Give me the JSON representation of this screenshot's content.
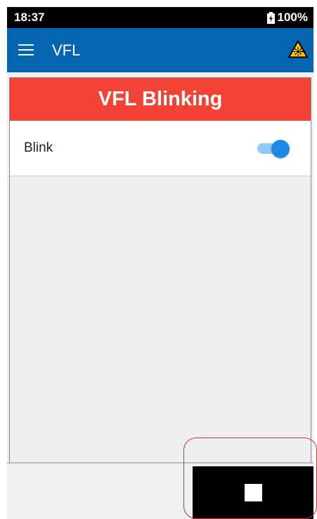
{
  "status_bar": {
    "time": "18:37",
    "battery": "100%",
    "battery_icon": "battery-charging-icon"
  },
  "app_bar": {
    "title": "VFL",
    "menu_icon": "hamburger-menu-icon",
    "warning_icon": "laser-warning-icon"
  },
  "banner": {
    "text": "VFL Blinking",
    "color": "#f44336"
  },
  "settings": [
    {
      "label": "Blink",
      "toggle_on": true
    }
  ],
  "actions": {
    "stop_icon": "stop-icon"
  },
  "colors": {
    "app_bar": "#0565b0",
    "accent": "#1e88e5",
    "status_bar": "#000000"
  }
}
